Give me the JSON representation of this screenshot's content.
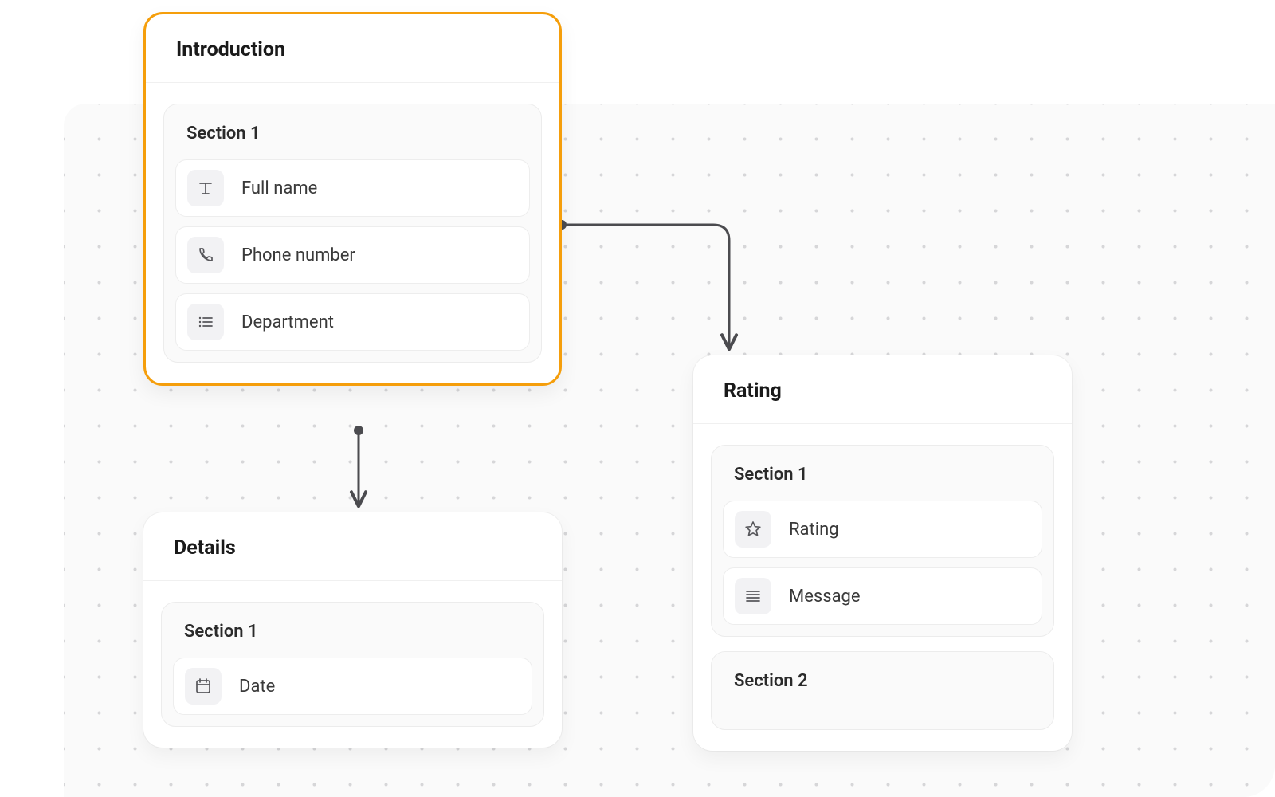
{
  "cards": {
    "intro": {
      "title": "Introduction",
      "sections": [
        {
          "title": "Section 1",
          "fields": [
            {
              "icon": "text",
              "label": "Full name"
            },
            {
              "icon": "phone",
              "label": "Phone number"
            },
            {
              "icon": "list",
              "label": "Department"
            }
          ]
        }
      ]
    },
    "rating": {
      "title": "Rating",
      "sections": [
        {
          "title": "Section 1",
          "fields": [
            {
              "icon": "star",
              "label": "Rating"
            },
            {
              "icon": "lines",
              "label": "Message"
            }
          ]
        },
        {
          "title": "Section 2",
          "fields": []
        }
      ]
    },
    "details": {
      "title": "Details",
      "sections": [
        {
          "title": "Section 1",
          "fields": [
            {
              "icon": "calendar",
              "label": "Date"
            }
          ]
        }
      ]
    }
  },
  "colors": {
    "accent": "#f59e0b",
    "connector": "#4b4b4f"
  }
}
